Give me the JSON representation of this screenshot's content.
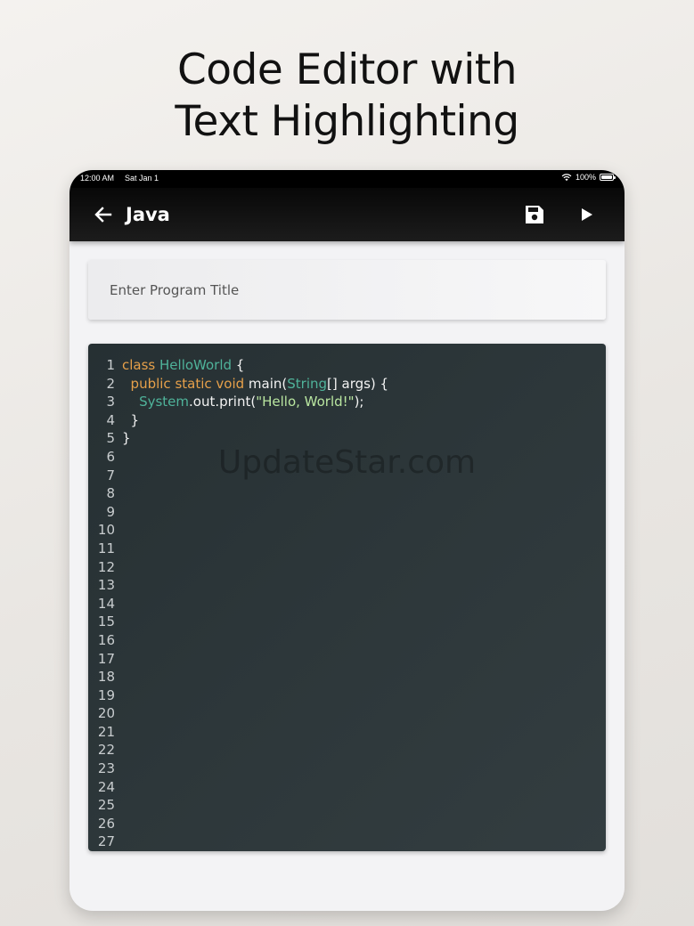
{
  "promo": {
    "line1": "Code Editor with",
    "line2": "Text Highlighting"
  },
  "status_bar": {
    "time": "12:00 AM",
    "date": "Sat Jan 1",
    "battery": "100%"
  },
  "app_bar": {
    "title": "Java",
    "icons": [
      "arrow-left-icon",
      "floppy-disk-icon",
      "play-icon"
    ]
  },
  "title_input": {
    "placeholder": "Enter Program Title",
    "value": ""
  },
  "editor": {
    "line_numbers": [
      "1",
      "2",
      "3",
      "4",
      "5",
      "6",
      "7",
      "8",
      "9",
      "10",
      "11",
      "12",
      "13",
      "14",
      "15",
      "16",
      "17",
      "18",
      "19",
      "20",
      "21",
      "22",
      "23",
      "24",
      "25",
      "26",
      "27"
    ],
    "lines": [
      [
        {
          "t": "class ",
          "k": "keyword"
        },
        {
          "t": "HelloWorld",
          "k": "type"
        },
        {
          "t": " {",
          "k": "plain"
        }
      ],
      [
        {
          "t": "  ",
          "k": "plain"
        },
        {
          "t": "public static void ",
          "k": "keyword"
        },
        {
          "t": "main(",
          "k": "plain"
        },
        {
          "t": "String",
          "k": "type"
        },
        {
          "t": "[] args) {",
          "k": "plain"
        }
      ],
      [
        {
          "t": "    ",
          "k": "plain"
        },
        {
          "t": "System",
          "k": "type"
        },
        {
          "t": ".out.print(",
          "k": "plain"
        },
        {
          "t": "\"Hello, World!\"",
          "k": "string"
        },
        {
          "t": ");",
          "k": "plain"
        }
      ],
      [
        {
          "t": "  }",
          "k": "plain"
        }
      ],
      [
        {
          "t": "}",
          "k": "plain"
        }
      ]
    ],
    "colors": {
      "keyword": "#e6a04a",
      "type": "#4fb39a",
      "string": "#b9e6a0",
      "plain": "#f2f2f2",
      "background": "#2d373a"
    }
  },
  "watermark": "UpdateStar.com"
}
